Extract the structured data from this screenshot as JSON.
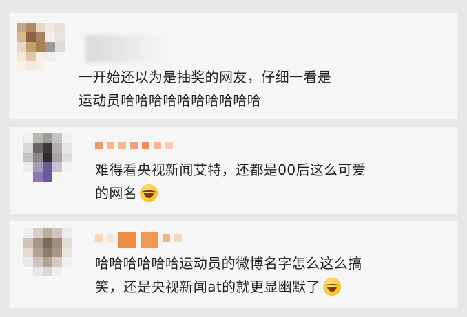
{
  "comments": [
    {
      "text_line1": "一开始还以为是抽奖的网友，仔细一看是",
      "text_line2": "运动员哈哈哈哈哈哈哈哈哈哈",
      "has_emoji": false,
      "name_censored": true,
      "avatar_colors": [
        "#c8a884",
        "#b28a63",
        "#e8d8c8",
        "#f0e9e2",
        "#e5e2de",
        "#d9b890",
        "#8a6440",
        "#a88460",
        "#f0efee",
        "#e6e3e0",
        "#ead8c4",
        "#c6a070",
        "#a68150",
        "#9e9a95",
        "#dcdcdc",
        "#f2e6d8",
        "#e0c8a8",
        "#f4efe8",
        "#eeeeee",
        "#f5f5f5",
        "#f8f1e8",
        "#f4ece0",
        "#f4f1ec",
        "#f6f6f6",
        "#f6f6f7"
      ]
    },
    {
      "text_line1": "难得看央视新闻艾特，还都是00后这么可爱",
      "text_line2": "的网名",
      "has_emoji": true,
      "name_censored": true,
      "name_colors": [
        "#f19a6a",
        "#f7b58e",
        "#f7b89a",
        "#f3a07a",
        "#f18a5c",
        "#f6b596",
        "#f9cbb2"
      ],
      "avatar_colors": [
        "#f1f1f2",
        "#b8b4b0",
        "#9f9a9a",
        "#c7c3c4",
        "#f1f1f2",
        "#d9d6d6",
        "#6c6566",
        "#3c3839",
        "#b3aeae",
        "#e6e4e4",
        "#c6c2c3",
        "#8e8888",
        "#2d2b2c",
        "#a7a3a4",
        "#dedcdd",
        "#ececed",
        "#a69cb5",
        "#6c5c93",
        "#c8c2d0",
        "#f3f3f4",
        "#f6f6f7",
        "#8d77b5",
        "#6d56a2",
        "#f4f4f5",
        "#f6f6f7"
      ]
    },
    {
      "text_line1": "哈哈哈哈哈哈运动员的微博名字怎么这么搞",
      "text_line2": "笑，还是央视新闻at的就更显幽默了",
      "has_emoji": true,
      "name_censored": true,
      "name_colors": [
        "#f7d5bf",
        "#fbe2d2",
        "#f08a3c",
        "#f19a55",
        "#f4b382",
        "#f9d8b8"
      ],
      "avatar_colors": [
        "#eeeeee",
        "#d7d0c8",
        "#b9ada0",
        "#cfc6bc",
        "#eceaea",
        "#cfc4b6",
        "#a49584",
        "#7a6a5a",
        "#9c8f80",
        "#e0dbd5",
        "#e3dcd2",
        "#b3a593",
        "#8c7c6b",
        "#a89888",
        "#e8e4e0",
        "#ecebea",
        "#cfc5ba",
        "#b0a393",
        "#d2cbc2",
        "#f2f1f0",
        "#f6f6f7",
        "#ebe8e5",
        "#dcd7d1",
        "#f0efee",
        "#f6f6f7"
      ]
    }
  ]
}
